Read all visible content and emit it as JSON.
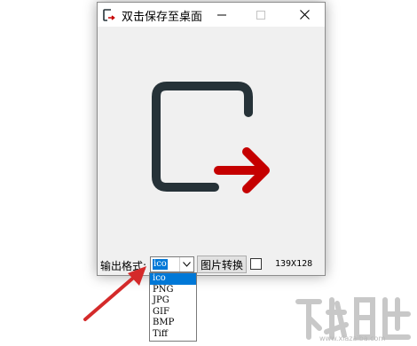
{
  "window": {
    "title": "双击保存至桌面",
    "controls": [
      "minimize-icon",
      "maximize-icon",
      "close-icon"
    ]
  },
  "canvas": {
    "icon": "export-arrow-icon",
    "colors": {
      "frame": "#263238",
      "arrow": "#c50000"
    }
  },
  "bottom": {
    "format_label": "输出格式:",
    "format_value": "ico",
    "convert_label": "图片转换",
    "checkbox_checked": false,
    "size_text": "139X128"
  },
  "dropdown": {
    "options": [
      "ico",
      "PNG",
      "JPG",
      "GIF",
      "BMP",
      "Tiff"
    ],
    "selected_index": 0
  },
  "annotation": {
    "arrow_color": "#d42a2a"
  },
  "watermark": {
    "url": "www.xiazaiba.com"
  },
  "colors": {
    "selection": "#0078d7",
    "window_bg": "#f0f0f0"
  }
}
